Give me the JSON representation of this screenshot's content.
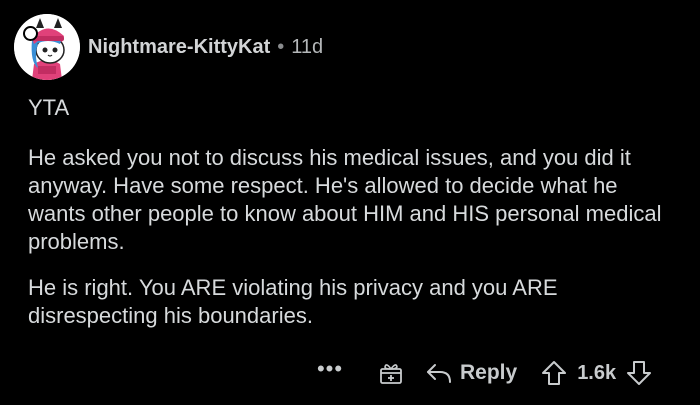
{
  "comment": {
    "author": "Nightmare-KittyKat",
    "separator": "•",
    "age": "11d",
    "paragraphs": [
      "YTA",
      "He asked you not to discuss his medical issues, and you did it anyway. Have some respect. He's allowed to decide what he wants other people to know about HIM and HIS personal medical problems.",
      "He is right. You ARE violating his privacy and you ARE disrespecting his boundaries."
    ]
  },
  "actions": {
    "more": "•••",
    "reply_label": "Reply",
    "score": "1.6k"
  },
  "icons": {
    "avatar": "cat-avatar-icon",
    "award": "gift-award-icon",
    "reply": "reply-arrow-icon",
    "upvote": "upvote-arrow-icon",
    "downvote": "downvote-arrow-icon"
  },
  "colors": {
    "background": "#000000",
    "text": "#d7dadc",
    "avatar_pink": "#e0417a",
    "avatar_blue": "#3a8fd6"
  }
}
